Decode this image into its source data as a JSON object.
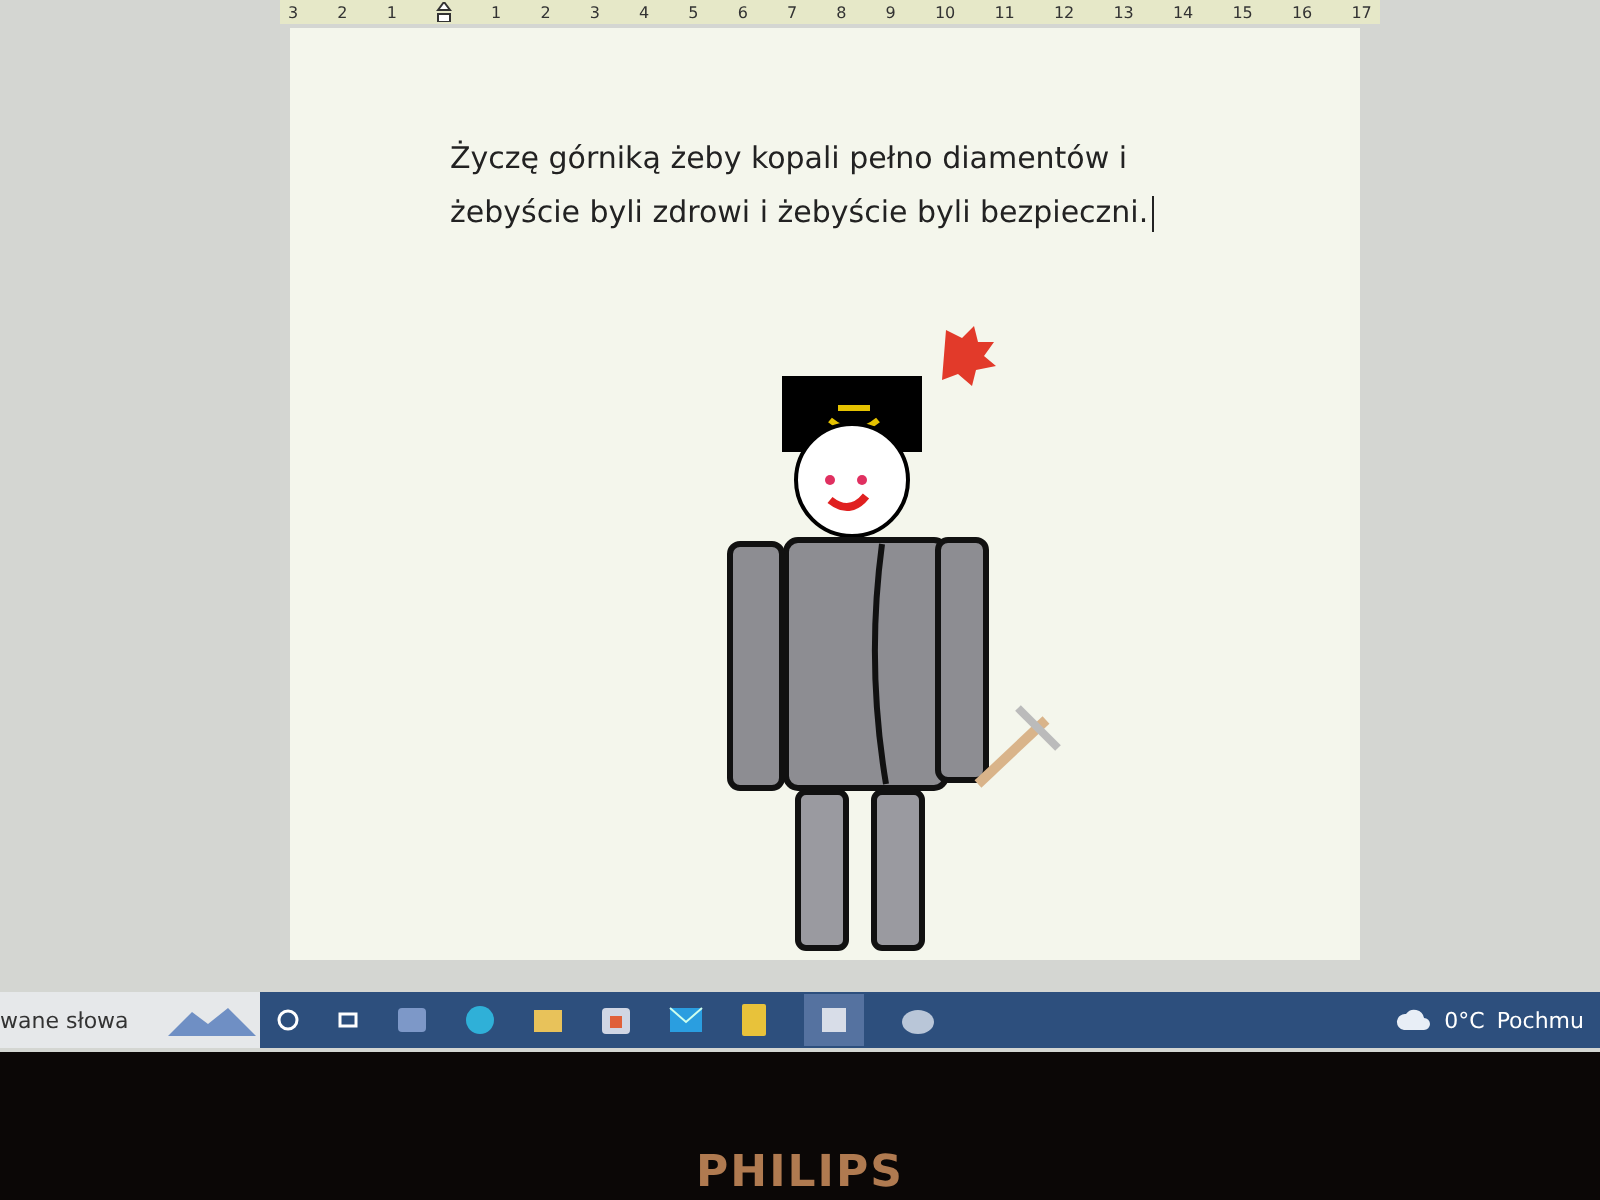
{
  "ruler": {
    "left_ticks": [
      "3",
      "2",
      "1"
    ],
    "right_ticks": [
      "1",
      "2",
      "3",
      "4",
      "5",
      "6",
      "7",
      "8",
      "9",
      "10",
      "11",
      "12",
      "13",
      "14",
      "15",
      "16",
      "17"
    ]
  },
  "document": {
    "lines": [
      "Życzę górniką żeby kopali pełno diamentów i",
      "żebyście byli zdrowi i żebyście byli bezpieczni."
    ]
  },
  "taskbar": {
    "search_text": "wane słowa",
    "weather": {
      "temperature": "0°C",
      "condition": "Pochmu"
    }
  },
  "monitor": {
    "brand": "PHILIPS"
  }
}
